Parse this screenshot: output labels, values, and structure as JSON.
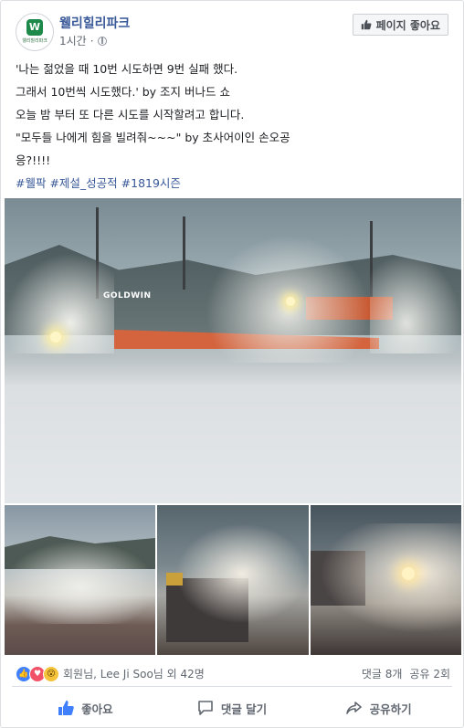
{
  "post": {
    "page_name": "웰리힐리파크",
    "timestamp": "1시간",
    "separator": "·",
    "like_page_label": "페이지 좋아요",
    "avatar_text": "웰리힐리파크",
    "lines": [
      "'나는 젊었을 때 10번 시도하면 9번 실패 했다.",
      "그래서 10번씩 시도했다.' by 조지 버나드 쇼",
      "오늘 밤 부터 또 다른 시도를 시작할려고 합니다.",
      "\"모두들 나에게 힘을 빌려줘~~~\" by 초사어이인 손오공",
      "응?!!!!"
    ],
    "hashtags": "#웰팍 #제설_성공적 #1819시즌",
    "photo_sign_text": "GOLDWIN"
  },
  "reactions": {
    "names": "회원님, Lee Ji Soo님 외 42명",
    "comments": "댓글 8개",
    "shares": "공유 2회",
    "icons": [
      "like-icon",
      "love-icon",
      "wow-icon"
    ]
  },
  "actions": {
    "like": "좋아요",
    "comment": "댓글 달기",
    "share": "공유하기"
  },
  "colors": {
    "link": "#385898",
    "secondary_text": "#606770",
    "like_blue": "#4080ff",
    "love_red": "#f25268",
    "wow_yellow": "#f5c33b"
  }
}
